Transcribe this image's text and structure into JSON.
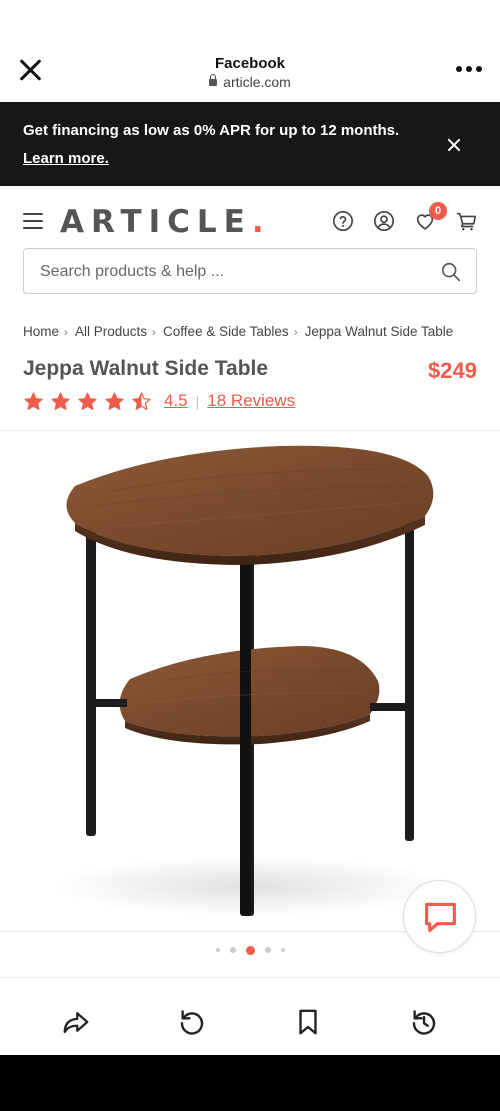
{
  "browser": {
    "title": "Facebook",
    "url": "article.com"
  },
  "promo": {
    "text": "Get financing as low as 0% APR for up to 12 months.",
    "link": "Learn more."
  },
  "header": {
    "logo": "ARTICLE",
    "logo_dot": ".",
    "wishlist_count": "0",
    "icons": [
      "menu-icon",
      "help-icon",
      "account-icon",
      "wishlist-heart-icon",
      "cart-icon"
    ]
  },
  "search": {
    "placeholder": "Search products & help ..."
  },
  "breadcrumb": [
    "Home",
    "All Products",
    "Coffee & Side Tables",
    "Jeppa Walnut Side Table"
  ],
  "product": {
    "title": "Jeppa Walnut Side Table",
    "price": "$249",
    "rating": "4.5",
    "rating_value": 4.5,
    "reviews": "18 Reviews"
  },
  "gallery": {
    "slide_count": 5,
    "active_slide": 3
  },
  "toolbar": {
    "icons": [
      "share-icon",
      "reload-icon",
      "bookmark-icon",
      "history-icon"
    ]
  },
  "colors": {
    "accent": "#f15b4a",
    "banner": "#171717",
    "walnut": "#7a4a2c"
  }
}
